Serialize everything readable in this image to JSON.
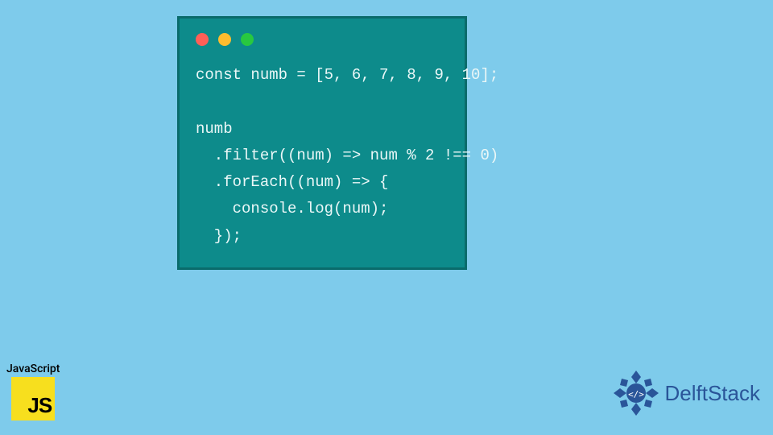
{
  "code_card": {
    "dots": [
      {
        "name": "close",
        "color": "#ff5f57"
      },
      {
        "name": "minimize",
        "color": "#febc2e"
      },
      {
        "name": "maximize",
        "color": "#28c840"
      }
    ],
    "code": "const numb = [5, 6, 7, 8, 9, 10];\n\nnumb\n  .filter((num) => num % 2 !== 0)\n  .forEach((num) => {\n    console.log(num);\n  });"
  },
  "js_badge": {
    "label": "JavaScript",
    "logo_text": "JS"
  },
  "delft_badge": {
    "text": "DelftStack"
  },
  "colors": {
    "background": "#7ecbeb",
    "card_bg": "#0d8b8b",
    "card_border": "#0a6b6b",
    "code_text": "#eaf7f7",
    "js_bg": "#f7df1e",
    "delft_blue": "#2a5599"
  }
}
